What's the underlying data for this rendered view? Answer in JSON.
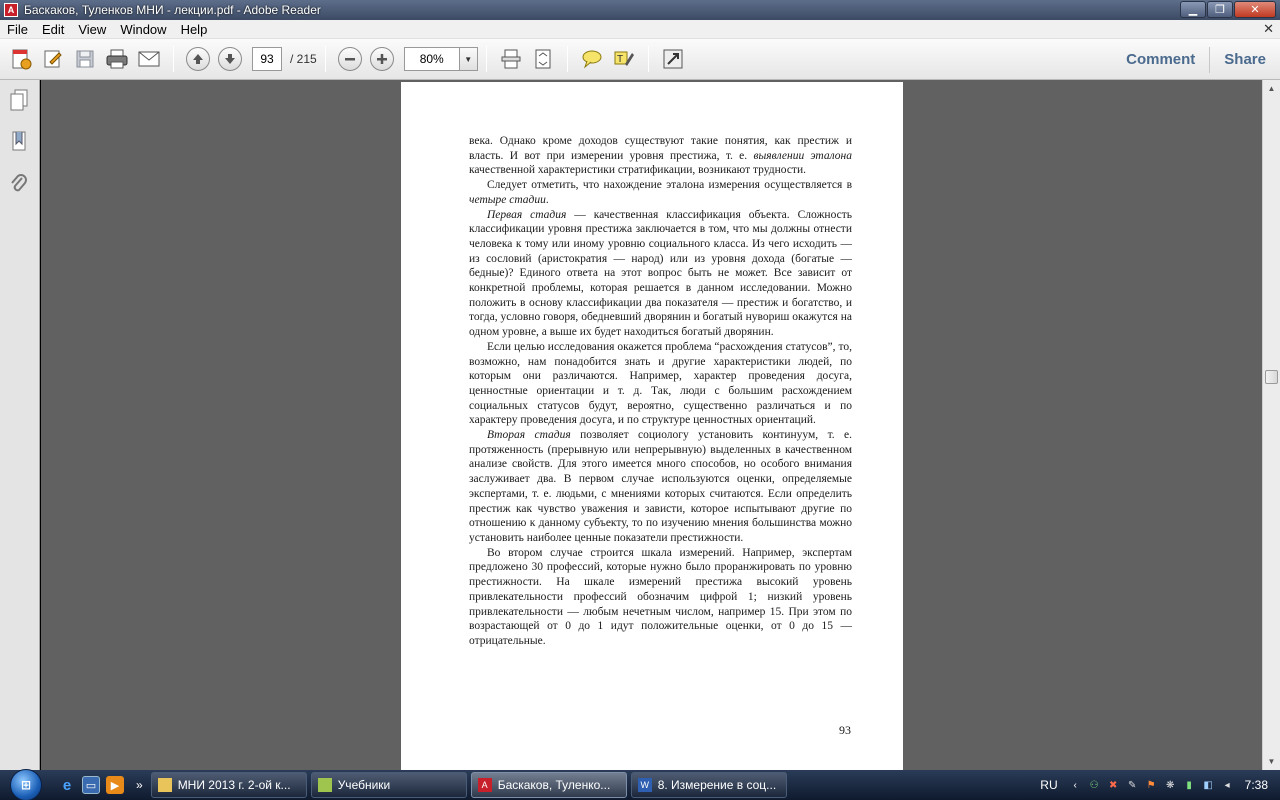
{
  "window": {
    "title": "Баскаков, Туленков МНИ - лекции.pdf - Adobe Reader",
    "controls": {
      "minimize": "▁",
      "maximize": "❐",
      "close": "✕"
    }
  },
  "menu": {
    "items": [
      "File",
      "Edit",
      "View",
      "Window",
      "Help"
    ],
    "close_glyph": "✕"
  },
  "toolbar": {
    "page_current": "93",
    "page_total": "/ 215",
    "zoom": "80%",
    "comment_label": "Comment",
    "share_label": "Share"
  },
  "document": {
    "paragraphs": [
      [
        {
          "t": "века. Однако кроме доходов существуют такие понятия, как престиж и власть. И вот при измерении уровня престижа, т. е. "
        },
        {
          "t": "выявлении эталона",
          "i": true
        },
        {
          "t": " качественной характеристики стратификации, возникают трудности."
        }
      ],
      [
        {
          "t": "Следует отметить, что нахождение эталона измерения осуществляется в "
        },
        {
          "t": "четыре стадии",
          "i": true
        },
        {
          "t": "."
        }
      ],
      [
        {
          "t": "Первая стадия",
          "i": true
        },
        {
          "t": " — качественная классификация объекта. Сложность классификации уровня престижа заключается в том, что мы должны отнести человека к тому или иному уровню социального класса. Из чего исходить — из сословий (аристократия — народ) или из уровня дохода (богатые — бедные)? Единого ответа на этот вопрос быть не может. Все зависит от конкретной проблемы, которая решается в данном исследовании. Можно положить в основу классификации два показателя — престиж и богатство, и тогда, условно говоря, обедневший дворянин и богатый нувориш окажутся на одном уровне, а выше их будет находиться богатый дворянин."
        }
      ],
      [
        {
          "t": "Если целью исследования окажется проблема “расхождения статусов”, то, возможно, нам понадобится знать и другие характеристики людей, по которым они различаются. Например, характер проведения досуга, ценностные ориентации и т. д. Так, люди с большим расхождением социальных статусов будут, вероятно, существенно различаться и по характеру проведения досуга, и по структуре ценностных ориентаций."
        }
      ],
      [
        {
          "t": "Вторая стадия",
          "i": true
        },
        {
          "t": " позволяет социологу установить континуум, т. е. протяженность (прерывную или непрерывную) выделенных в качественном анализе свойств. Для этого имеется много способов, но особого внимания заслуживает два. В первом случае используются оценки, определяемые экспертами, т. е. людьми, с мнениями которых считаются. Если определить престиж как чувство уважения и зависти, которое испытывают другие по отношению к данному субъекту, то по изучению мнения большинства можно установить наиболее ценные показатели престижности."
        }
      ],
      [
        {
          "t": "Во втором случае строится шкала измерений. Например, экспертам предложено 30 профессий, которые нужно было проранжировать по уровню престижности. На шкале измерений престижа высокий уровень привлекательности профессий обозначим цифрой 1; низкий уровень привлекательности — любым нечетным числом, например 15. При этом по возрастающей от 0 до 1 идут положительные оценки, от 0 до 15 — отрицательные."
        }
      ]
    ],
    "page_number": "93"
  },
  "taskbar": {
    "start_glyph": "⊞",
    "quick_more": "»",
    "buttons": [
      {
        "label": "МНИ 2013 г. 2-ой к...",
        "icon": "folder-icon",
        "color": "#e8c45a"
      },
      {
        "label": "Учебники",
        "icon": "winrar-icon",
        "color": "#9fc54e"
      },
      {
        "label": "Баскаков, Туленко...",
        "icon": "adobe-reader-icon",
        "color": "#c8202a"
      },
      {
        "label": "8. Измерение в соц...",
        "icon": "word-icon",
        "color": "#2f5fb0"
      }
    ],
    "language": "RU",
    "clock": "7:38"
  },
  "colors": {
    "doc_background": "#616161",
    "accent_link": "#4a6a8e"
  }
}
